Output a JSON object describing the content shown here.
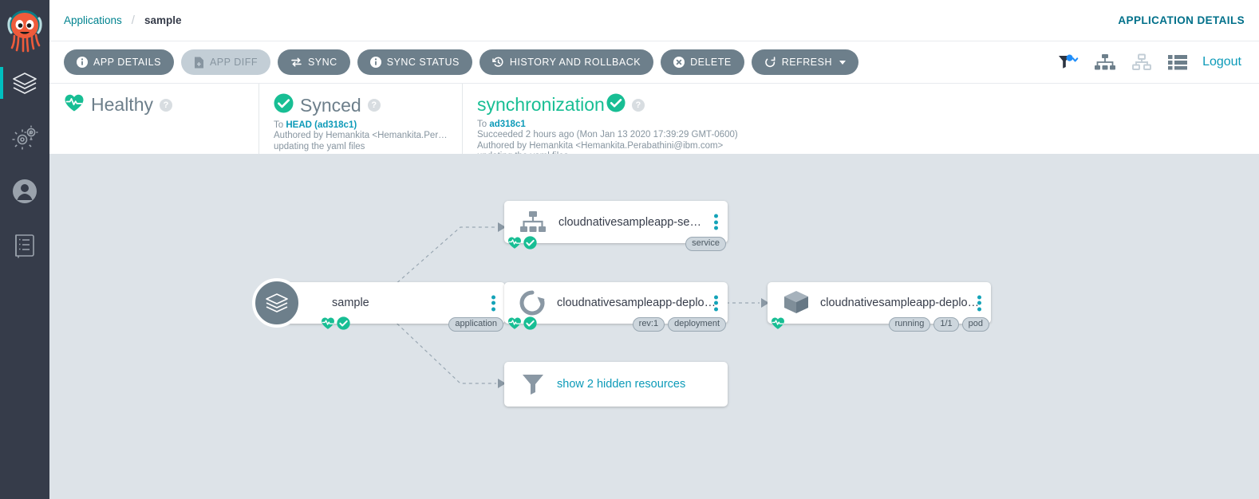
{
  "sidebar": {
    "logo_icon": "argo-octopus-logo",
    "items": [
      {
        "icon": "layers-icon",
        "name": "applications",
        "active": true
      },
      {
        "icon": "gears-icon",
        "name": "settings",
        "active": false
      },
      {
        "icon": "user-icon",
        "name": "user-info",
        "active": false
      },
      {
        "icon": "docs-book-icon",
        "name": "documentation",
        "active": false
      }
    ]
  },
  "topbar": {
    "breadcrumb_root": "Applications",
    "breadcrumb_separator": "/",
    "breadcrumb_current": "sample",
    "page_label": "APPLICATION DETAILS"
  },
  "actionbar": {
    "buttons": [
      {
        "label": "APP DETAILS",
        "icon": "info-icon",
        "disabled": false
      },
      {
        "label": "APP DIFF",
        "icon": "file-diff-icon",
        "disabled": true
      },
      {
        "label": "SYNC",
        "icon": "sync-arrows-icon",
        "disabled": false
      },
      {
        "label": "SYNC STATUS",
        "icon": "info-icon",
        "disabled": false
      },
      {
        "label": "HISTORY AND ROLLBACK",
        "icon": "history-clock-icon",
        "disabled": false
      },
      {
        "label": "DELETE",
        "icon": "close-circle-icon",
        "disabled": false
      },
      {
        "label": "REFRESH",
        "icon": "refresh-icon",
        "disabled": false,
        "caret": true
      }
    ],
    "tools": [
      {
        "icon": "filter-funnel-icon",
        "name": "filter-dropdown"
      },
      {
        "icon": "tree-view-icon",
        "name": "tree-view-toggle"
      },
      {
        "icon": "network-view-icon",
        "name": "network-view-toggle"
      },
      {
        "icon": "list-view-icon",
        "name": "list-view-toggle"
      }
    ],
    "logout_label": "Logout"
  },
  "status": {
    "health": {
      "icon": "heart-pulse-icon",
      "title": "Healthy",
      "help": "?"
    },
    "sync": {
      "icon": "check-circle-icon",
      "title": "Synced",
      "help": "?",
      "line_to_prefix": "To ",
      "line_to_rev": "HEAD (ad318c1)",
      "line_author": "Authored by Hemankita <Hemankita.Per…",
      "line_message": "updating the yaml files"
    },
    "operation": {
      "title": "synchronization",
      "icon": "check-circle-icon",
      "help": "?",
      "line_to_prefix": "To ",
      "line_to_rev": "ad318c1",
      "line_result": "Succeeded 2 hours ago (Mon Jan 13 2020 17:39:29 GMT-0600)",
      "line_author": "Authored by Hemankita <Hemankita.Perabathini@ibm.com>",
      "line_message": "updating the yaml files"
    }
  },
  "graph": {
    "nodes": [
      {
        "id": "app",
        "icon": "layers-icon",
        "label": "sample",
        "kind_tags": [
          "application"
        ],
        "badges": [
          "heart-pulse-badge",
          "check-circle-badge"
        ]
      },
      {
        "id": "service",
        "icon": "service-hierarchy-icon",
        "label": "cloudnativesampleapp-service",
        "kind_tags": [
          "service"
        ],
        "badges": [
          "heart-pulse-badge",
          "check-circle-badge"
        ]
      },
      {
        "id": "deployment",
        "icon": "deployment-circular-arrow-icon",
        "label": "cloudnativesampleapp-deployment",
        "kind_tags": [
          "rev:1",
          "deployment"
        ],
        "badges": [
          "heart-pulse-badge",
          "check-circle-badge"
        ]
      },
      {
        "id": "pod",
        "icon": "pod-cube-icon",
        "label": "cloudnativesampleapp-deploymen…",
        "kind_tags": [
          "running",
          "1/1",
          "pod"
        ],
        "badges": [
          "heart-pulse-badge"
        ]
      },
      {
        "id": "hidden",
        "icon": "filter-funnel-icon",
        "label": "show 2 hidden resources",
        "kind_tags": [],
        "badges": []
      }
    ]
  },
  "colors": {
    "sidebar_bg": "#363c4a",
    "accent_teal": "#0c9ab8",
    "healthy_green": "#18be94",
    "button_gray": "#6d7f8b",
    "canvas_bg": "#dde3e8",
    "active_indicator": "#00bfbf",
    "filter_blue": "#1f8efa"
  }
}
